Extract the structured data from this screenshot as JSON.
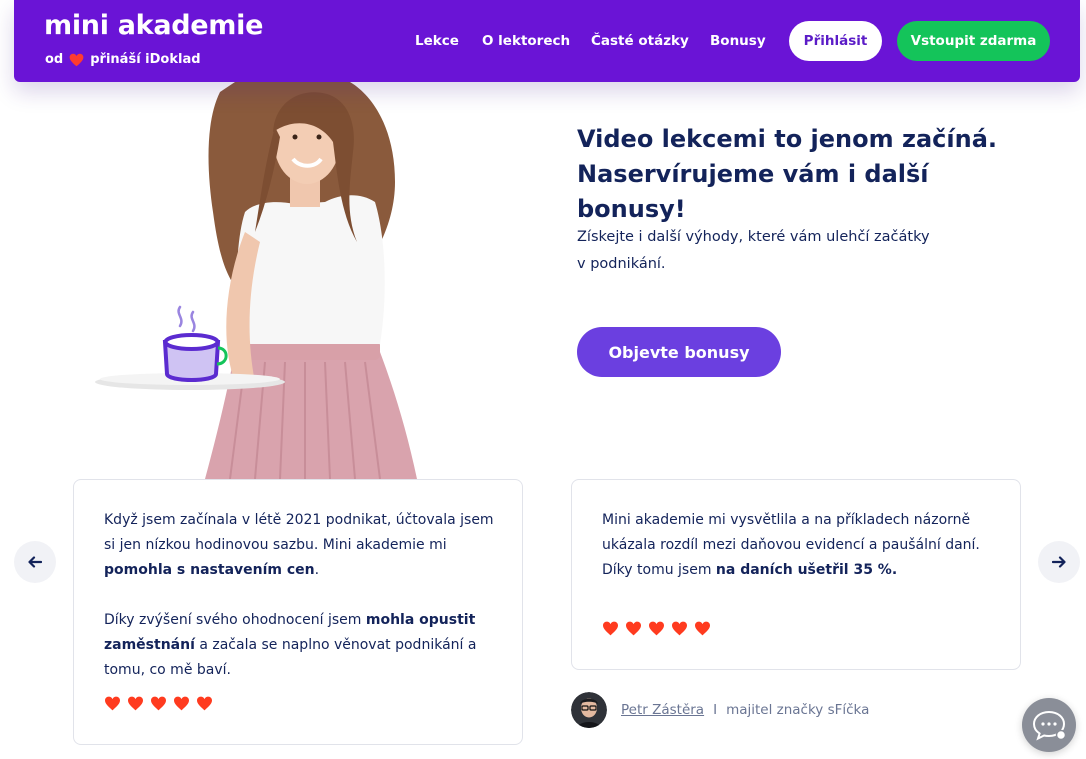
{
  "header": {
    "logo_title": "mini akademie",
    "logo_sub_prefix": "od",
    "logo_sub_suffix": "přináší iDoklad",
    "nav": [
      "Lekce",
      "O lektorech",
      "Časté otázky",
      "Bonusy"
    ],
    "login_label": "Přihlásit",
    "join_label": "Vstoupit zdarma",
    "colors": {
      "bg": "#6a14d6",
      "join": "#14c45a",
      "heart": "#ff3b30"
    }
  },
  "hero": {
    "title_line1": "Video lekcemi to jenom začíná.",
    "title_line2": "Naservírujeme vám i další bonusy!",
    "text_line1": "Získejte i další výhody, které vám ulehčí začátky",
    "text_line2": "v podnikání.",
    "button_label": "Objevte bonusy",
    "button_color": "#6b3fe0"
  },
  "testimonials": [
    {
      "p1_a": "Když jsem začínala v létě 2021 podnikat, účtovala jsem si jen nízkou hodinovou sazbu. Mini akademie mi ",
      "p1_b": "pomohla s nastavením cen",
      "p1_c": ".",
      "p2_a": "Díky zvýšení svého ohodnocení jsem ",
      "p2_b": "mohla opustit zaměstnání",
      "p2_c": " a začala se naplno věnovat podnikání a tomu, co mě baví.",
      "rating": 5
    },
    {
      "p1_a": "Mini akademie mi vysvětlila a na příkladech názorně ukázala rozdíl mezi daňovou evidencí a paušální daní. Díky tomu jsem ",
      "p1_b": "na daních ušetřil 35 %",
      "p1_c": ".",
      "rating": 5,
      "author_name": "Petr Zástěra",
      "author_sep": "I",
      "author_role": "majitel značky sFíčka"
    }
  ],
  "icons": {
    "prev": "arrow-left-icon",
    "next": "arrow-right-icon",
    "chat": "chat-bubble-icon",
    "rating": "heart-icon"
  }
}
